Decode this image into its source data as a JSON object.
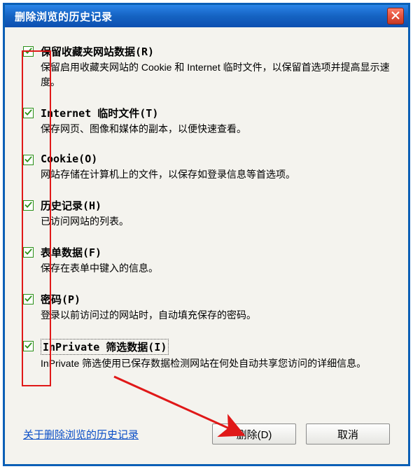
{
  "title": "删除浏览的历史记录",
  "options": [
    {
      "label": "保留收藏夹网站数据(R)",
      "desc": "保留启用收藏夹网站的 Cookie 和 Internet 临时文件，以保留首选项并提高显示速度。",
      "checked": true
    },
    {
      "label": "Internet 临时文件(T)",
      "desc": "保存网页、图像和媒体的副本，以便快速查看。",
      "checked": true
    },
    {
      "label": "Cookie(O)",
      "desc": "网站存储在计算机上的文件，以保存如登录信息等首选项。",
      "checked": true
    },
    {
      "label": "历史记录(H)",
      "desc": "已访问网站的列表。",
      "checked": true
    },
    {
      "label": "表单数据(F)",
      "desc": "保存在表单中键入的信息。",
      "checked": true
    },
    {
      "label": "密码(P)",
      "desc": "登录以前访问过的网站时，自动填充保存的密码。",
      "checked": true
    },
    {
      "label": "InPrivate 筛选数据(I)",
      "desc": "InPrivate 筛选使用已保存数据检测网站在何处自动共享您访问的详细信息。",
      "checked": true,
      "focused": true
    }
  ],
  "footer": {
    "about_link": "关于删除浏览的历史记录",
    "delete_button": "删除(D)",
    "cancel_button": "取消"
  }
}
